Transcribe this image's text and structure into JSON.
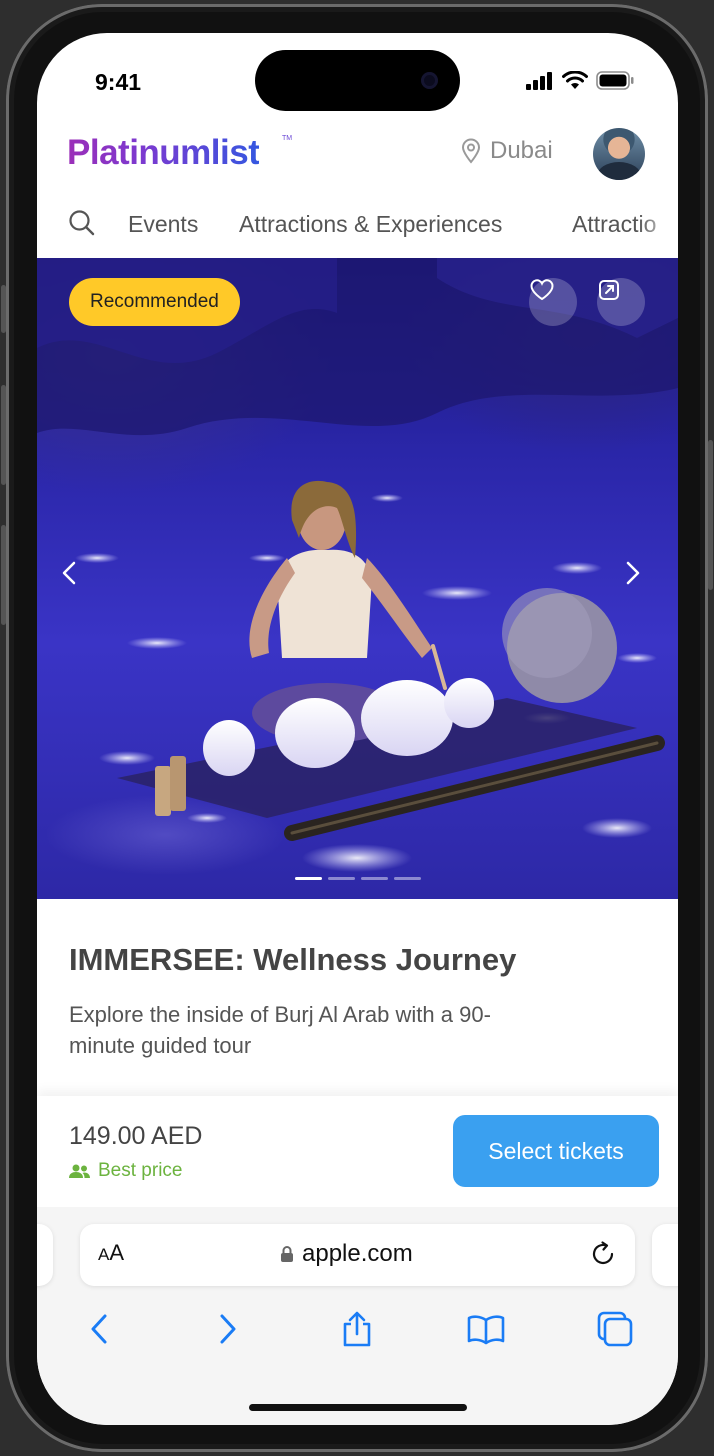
{
  "status_bar": {
    "time": "9:41"
  },
  "header": {
    "logo": "Platinumlist",
    "logo_tm": "TM",
    "location": "Dubai",
    "location_icon": "map-pin-icon",
    "avatar": "user-avatar"
  },
  "nav": {
    "search_icon": "search-icon",
    "items": [
      "Events",
      "Attractions & Experiences",
      "Attractio"
    ]
  },
  "hero": {
    "badge": "Recommended",
    "favorite_icon": "heart-icon",
    "share_icon": "share-icon",
    "prev_icon": "chevron-left-icon",
    "next_icon": "chevron-right-icon",
    "slides_count": 4,
    "active_slide": 1
  },
  "event": {
    "title": "IMMERSEE: Wellness Journey",
    "description": "Explore the inside of Burj Al Arab with a 90-minute guided tour"
  },
  "purchase": {
    "price": "149.00 AED",
    "best_price_label": "Best price",
    "best_price_icon": "people-icon",
    "cta_label": "Select tickets"
  },
  "safari": {
    "aa_small": "A",
    "aa_large": "A",
    "url": "apple.com",
    "lock_icon": "lock-icon",
    "reload_icon": "reload-icon",
    "toolbar": [
      "back-icon",
      "forward-icon",
      "share-icon",
      "bookmarks-icon",
      "tabs-icon"
    ]
  },
  "colors": {
    "accent_blue": "#3aa0f0",
    "badge_yellow": "#ffc928",
    "best_price_green": "#6cb33f",
    "safari_blue": "#1a7cf5"
  }
}
